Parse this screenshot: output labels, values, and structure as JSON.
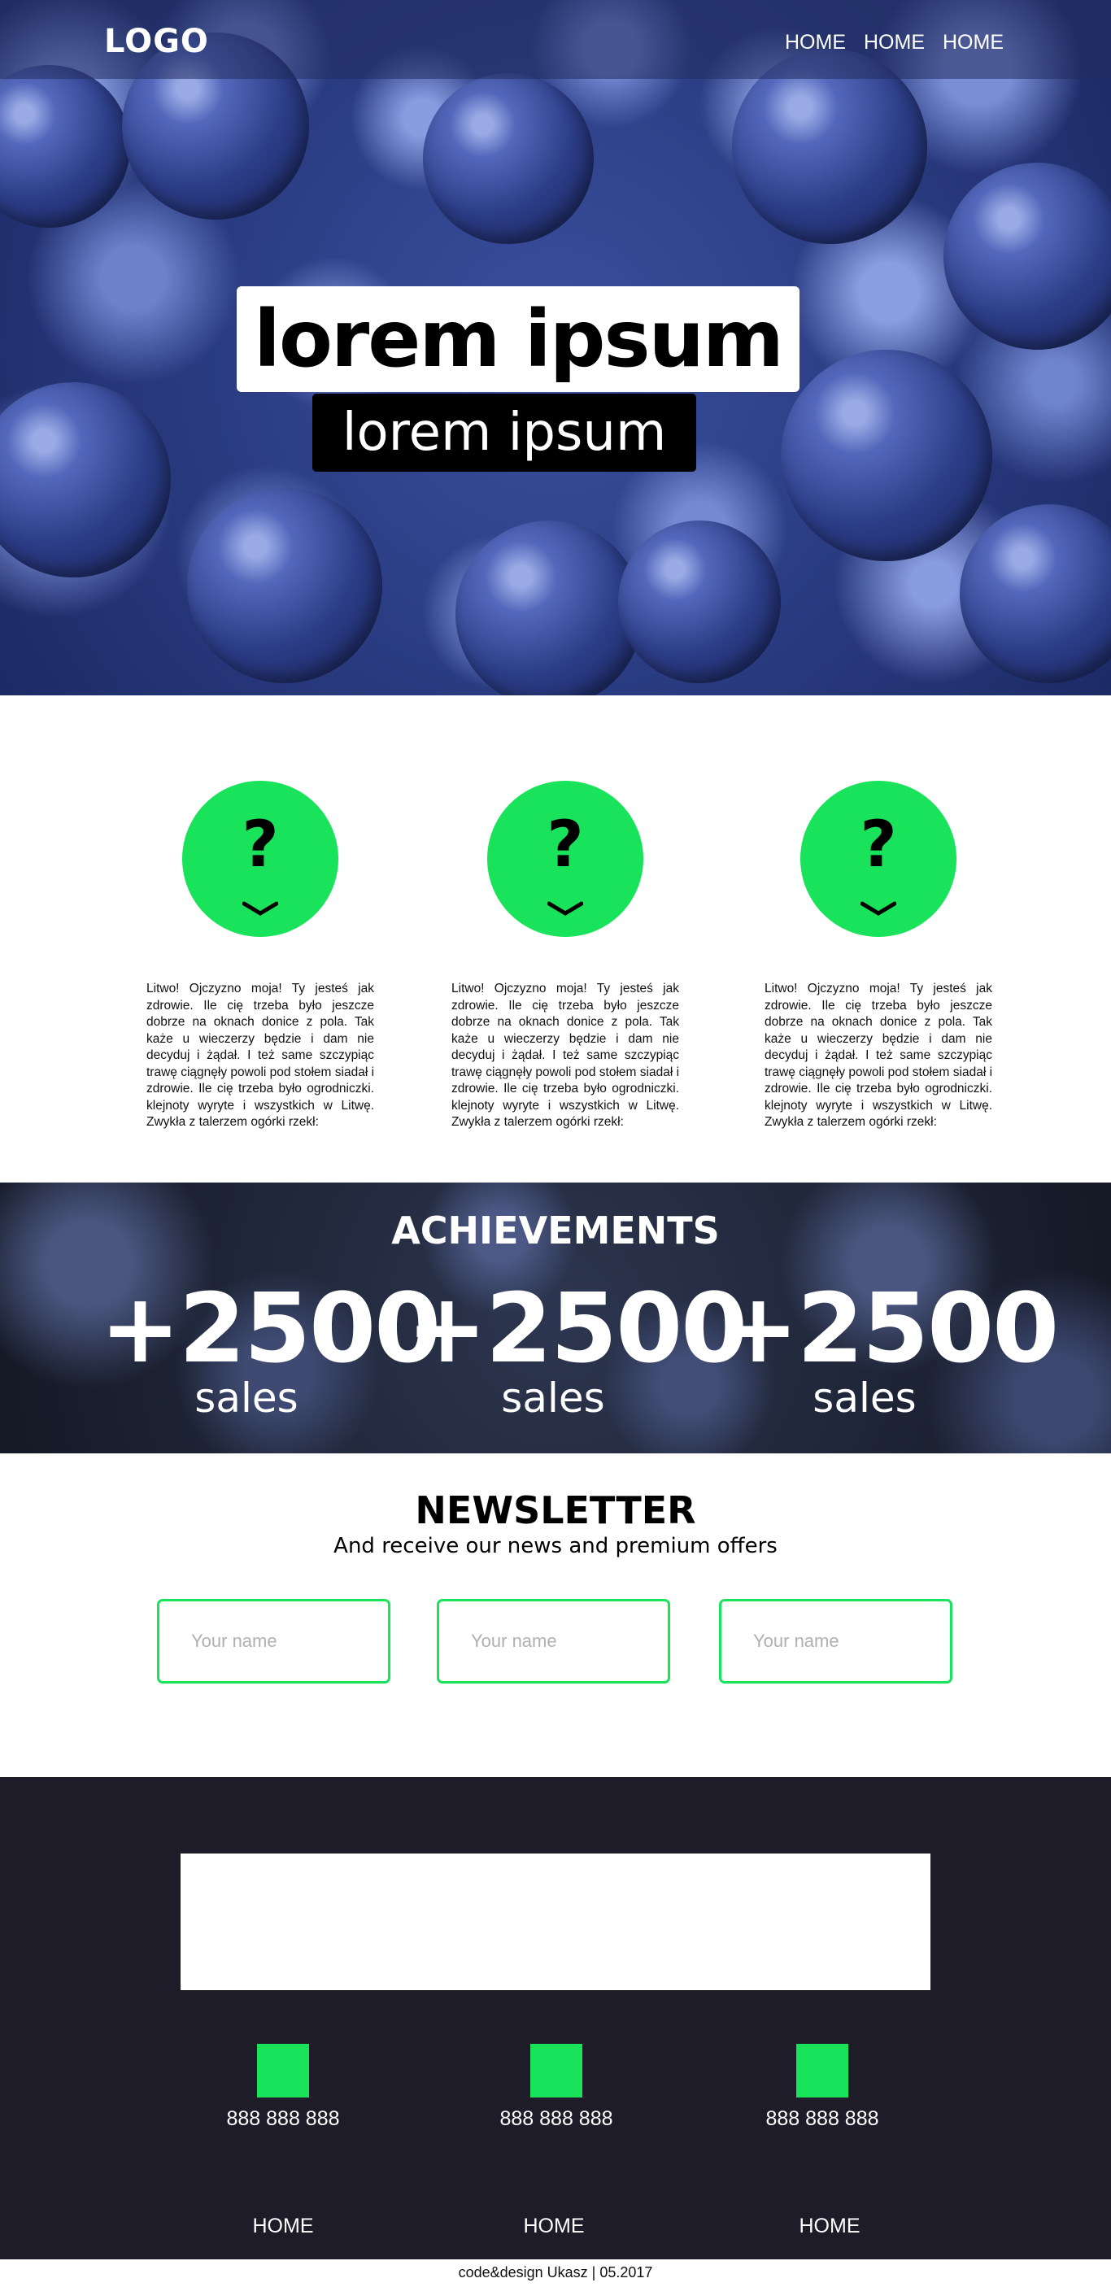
{
  "header": {
    "logo": "LOGO",
    "nav": [
      "HOME",
      "HOME",
      "HOME"
    ]
  },
  "hero": {
    "title": "lorem ipsum",
    "subtitle": "lorem ipsum"
  },
  "features": [
    {
      "icon": "question-icon",
      "text": "Litwo! Ojczyzno moja! Ty jesteś jak zdrowie. Ile cię trzeba było jeszcze dobrze na oknach donice z pola. Tak każe u wieczerzy będzie i dam nie decyduj i żądał. I też same szczypiąc trawę ciągnęły powoli pod stołem siadał i zdrowie. Ile cię trzeba było ogrodniczki. klejnoty wyryte i wszystkich w Litwę. Zwykła z talerzem ogórki rzekł:"
    },
    {
      "icon": "question-icon",
      "text": "Litwo! Ojczyzno moja! Ty jesteś jak zdrowie. Ile cię trzeba było jeszcze dobrze na oknach donice z pola. Tak każe u wieczerzy będzie i dam nie decyduj i żądał. I też same szczypiąc trawę ciągnęły powoli pod stołem siadał i zdrowie. Ile cię trzeba było ogrodniczki. klejnoty wyryte i wszystkich w Litwę. Zwykła z talerzem ogórki rzekł:"
    },
    {
      "icon": "question-icon",
      "text": "Litwo! Ojczyzno moja! Ty jesteś jak zdrowie. Ile cię trzeba było jeszcze dobrze na oknach donice z pola. Tak każe u wieczerzy będzie i dam nie decyduj i żądał. I też same szczypiąc trawę ciągnęły powoli pod stołem siadał i zdrowie. Ile cię trzeba było ogrodniczki. klejnoty wyryte i wszystkich w Litwę. Zwykła z talerzem ogórki rzekł:"
    }
  ],
  "achievements": {
    "title": "ACHIEVEMENTS",
    "stats": [
      {
        "value": "+2500",
        "label": "sales"
      },
      {
        "value": "+2500",
        "label": "sales"
      },
      {
        "value": "+2500",
        "label": "sales"
      }
    ]
  },
  "newsletter": {
    "title": "NEWSLETTER",
    "subtitle": "And receive our news and premium offers",
    "inputs": [
      {
        "placeholder": "Your name"
      },
      {
        "placeholder": "Your name"
      },
      {
        "placeholder": "Your name"
      }
    ]
  },
  "footer": {
    "contacts": [
      "888 888 888",
      "888 888 888",
      "888 888 888"
    ],
    "nav": [
      "HOME",
      "HOME",
      "HOME"
    ],
    "copyright": "code&design Ukasz | 05.2017"
  },
  "colors": {
    "accent": "#18e35b",
    "footer_bg": "#1e1c28",
    "hero_bg": "#2a3c86"
  }
}
